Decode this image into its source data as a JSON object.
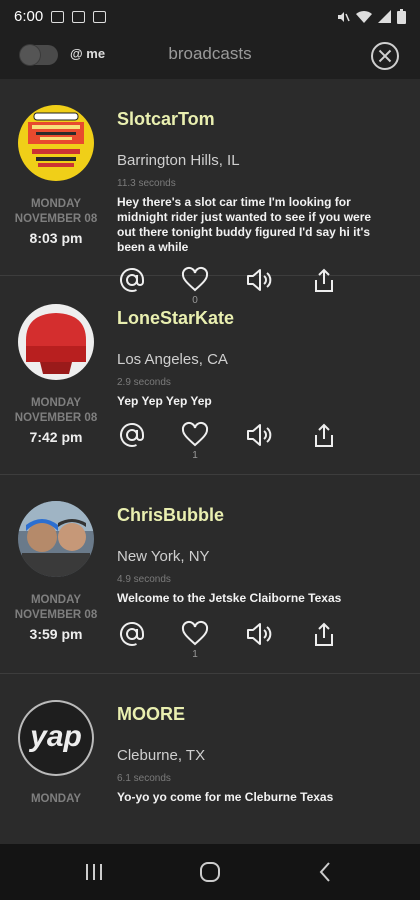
{
  "status_bar": {
    "time": "6:00"
  },
  "header": {
    "toggle_label": "@ me",
    "title": "broadcasts"
  },
  "posts": [
    {
      "username": "SlotcarTom",
      "location": "Barrington Hills, IL",
      "seconds": "11.3 seconds",
      "message": "Hey there's a slot car time I'm looking for midnight rider just wanted to see if you were out there tonight buddy figured I'd say hi it's been a while",
      "day": "MONDAY",
      "month": "NOVEMBER 08",
      "time": "8:03 pm",
      "likes": "0"
    },
    {
      "username": "LoneStarKate",
      "location": "Los Angeles, CA",
      "seconds": "2.9 seconds",
      "message": "Yep Yep Yep Yep",
      "day": "MONDAY",
      "month": "NOVEMBER 08",
      "time": "7:42 pm",
      "likes": "1"
    },
    {
      "username": "ChrisBubble",
      "location": "New York, NY",
      "seconds": "4.9 seconds",
      "message": "Welcome to the Jetske Claiborne Texas",
      "day": "MONDAY",
      "month": "NOVEMBER 08",
      "time": "3:59 pm",
      "likes": "1"
    },
    {
      "username": "MOORE",
      "location": "Cleburne, TX",
      "seconds": "6.1 seconds",
      "message": "Yo-yo yo come for me Cleburne Texas",
      "day": "MONDAY",
      "avatar_text": "yap"
    }
  ],
  "colors": {
    "username": "#e9efb0",
    "background": "#2b2b2b",
    "bars": "#1f1f1f"
  }
}
